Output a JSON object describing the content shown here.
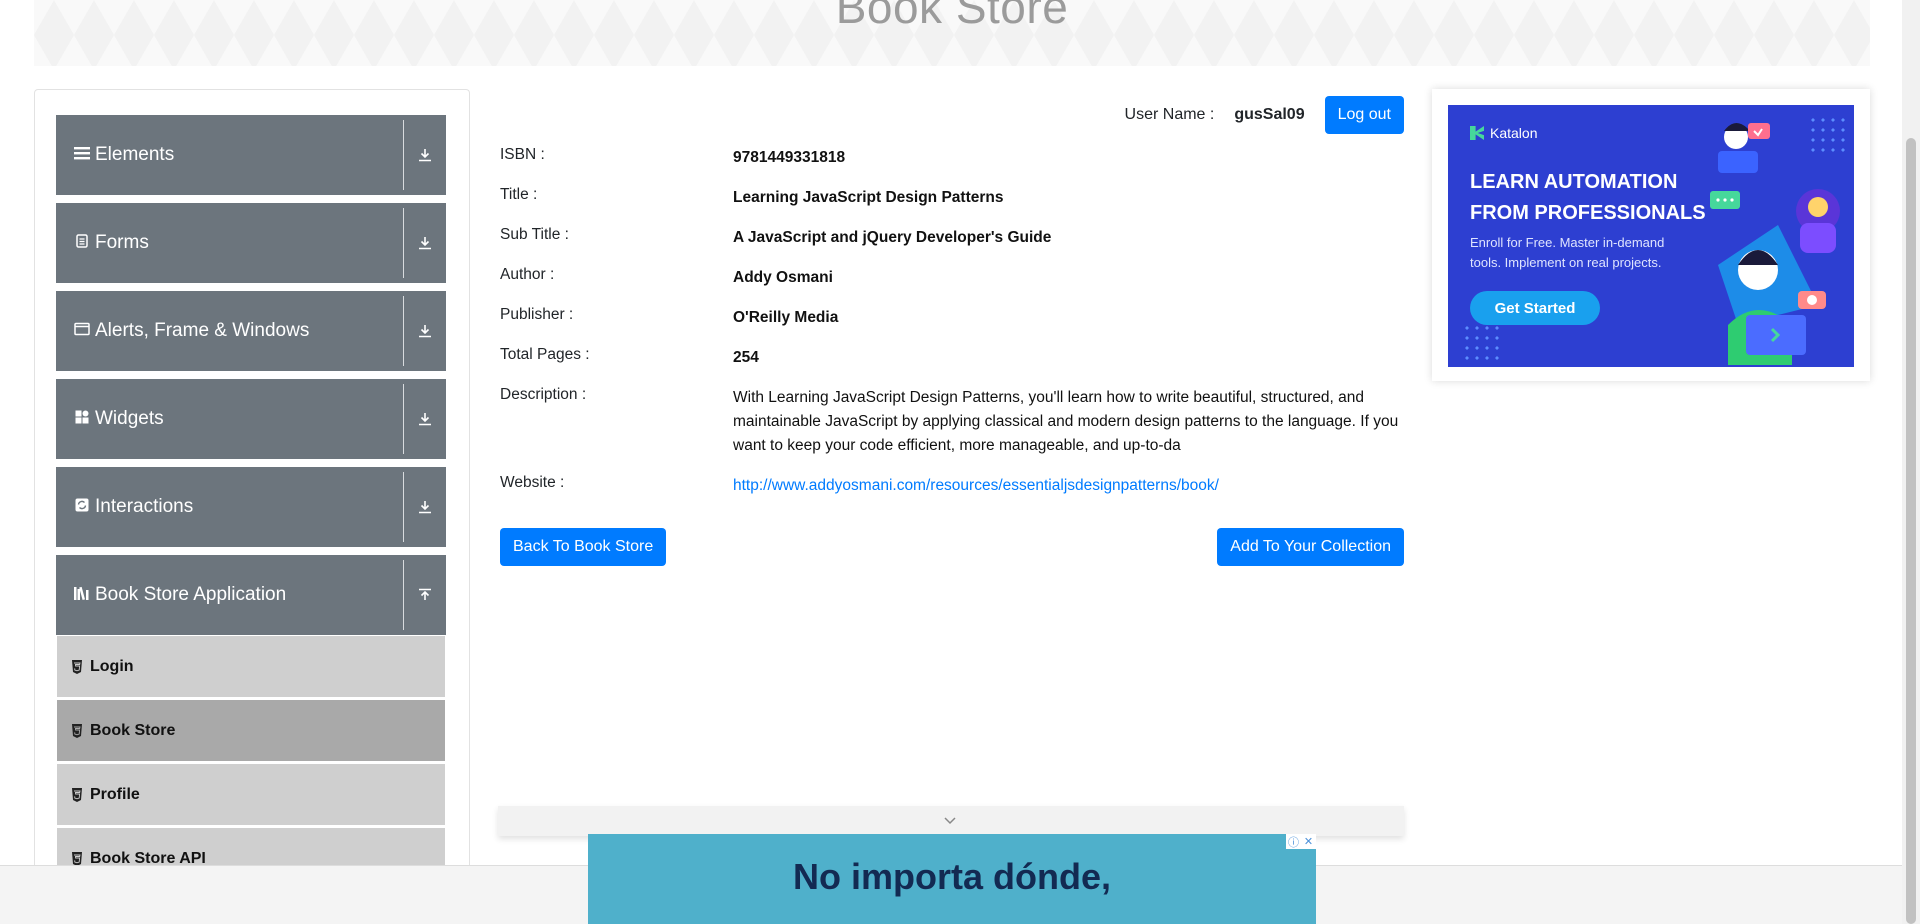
{
  "header": {
    "title": "Book Store"
  },
  "sidebar": {
    "groups": [
      {
        "label": "Elements",
        "icon": "hamburger-icon",
        "arrow": "download-icon"
      },
      {
        "label": "Forms",
        "icon": "document-icon",
        "arrow": "download-icon"
      },
      {
        "label": "Alerts, Frame & Windows",
        "icon": "window-icon",
        "arrow": "download-icon"
      },
      {
        "label": "Widgets",
        "icon": "widgets-icon",
        "arrow": "download-icon"
      },
      {
        "label": "Interactions",
        "icon": "interactions-icon",
        "arrow": "download-icon"
      },
      {
        "label": "Book Store Application",
        "icon": "books-icon",
        "arrow": "upload-icon"
      }
    ],
    "subitems": [
      {
        "label": "Login",
        "active": false
      },
      {
        "label": "Book Store",
        "active": true
      },
      {
        "label": "Profile",
        "active": false
      },
      {
        "label": "Book Store API",
        "active": false
      }
    ]
  },
  "user": {
    "label": "User Name :",
    "value": "gusSal09",
    "logout_label": "Log out"
  },
  "book": {
    "isbn": {
      "label": "ISBN :",
      "value": "9781449331818"
    },
    "title": {
      "label": "Title :",
      "value": "Learning JavaScript Design Patterns"
    },
    "subtitle": {
      "label": "Sub Title :",
      "value": "A JavaScript and jQuery Developer's Guide"
    },
    "author": {
      "label": "Author :",
      "value": "Addy Osmani"
    },
    "publisher": {
      "label": "Publisher :",
      "value": "O'Reilly Media"
    },
    "pages": {
      "label": "Total Pages :",
      "value": "254"
    },
    "description": {
      "label": "Description :",
      "value": "With Learning JavaScript Design Patterns, you'll learn how to write beautiful, structured, and maintainable JavaScript by applying classical and modern design patterns to the language. If you want to keep your code efficient, more manageable, and up-to-da"
    },
    "website": {
      "label": "Website :",
      "value": "http://www.addyosmani.com/resources/essentialjsdesignpatterns/book/"
    }
  },
  "actions": {
    "back_label": "Back To Book Store",
    "add_label": "Add To Your Collection"
  },
  "ad": {
    "brand": "Katalon",
    "headline_1": "LEARN AUTOMATION",
    "headline_2": "FROM PROFESSIONALS",
    "sub_1": "Enroll for Free. Master in-demand",
    "sub_2": "tools. Implement on real projects.",
    "cta": "Get Started"
  },
  "bottom_ad": {
    "text": "No importa dónde,"
  },
  "colors": {
    "primary": "#007bff",
    "sidebar_group": "#6c757d",
    "sub_item": "#cfcfcf",
    "sub_item_active": "#a9a9a9"
  }
}
